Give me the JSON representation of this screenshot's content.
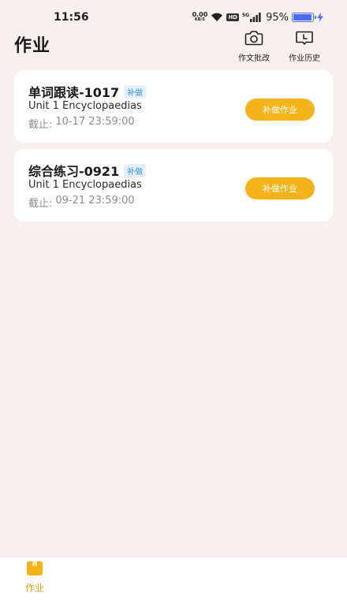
{
  "status_bar": {
    "time": "11:56",
    "net_speed_value": "0.00",
    "net_speed_unit": "KB/S",
    "hd_badge": "HD",
    "network_type": "5G",
    "battery_percent": "95%",
    "battery_level": 0.95
  },
  "header": {
    "title": "作业",
    "actions": [
      {
        "label": "作文批改",
        "icon": "camera-icon"
      },
      {
        "label": "作业历史",
        "icon": "clock-book-icon"
      }
    ]
  },
  "assignments": [
    {
      "title": "单词跟读-1017",
      "tag": "补做",
      "subtitle": "Unit 1 Encyclopaedias",
      "deadline_label": "截止:",
      "deadline": "10-17 23:59:00",
      "button_label": "补做作业"
    },
    {
      "title": "综合练习-0921",
      "tag": "补做",
      "subtitle": "Unit 1 Encyclopaedias",
      "deadline_label": "截止:",
      "deadline": "09-21 23:59:00",
      "button_label": "补做作业"
    }
  ],
  "bottom_nav": {
    "items": [
      {
        "label": "作业",
        "icon": "homework-icon",
        "active": true
      }
    ]
  },
  "colors": {
    "background": "#f6f0ef",
    "accent": "#f5b31a",
    "tag_text": "#3a8fd9",
    "tag_background": "#e3f0fb",
    "battery": "#4a6cf7"
  }
}
